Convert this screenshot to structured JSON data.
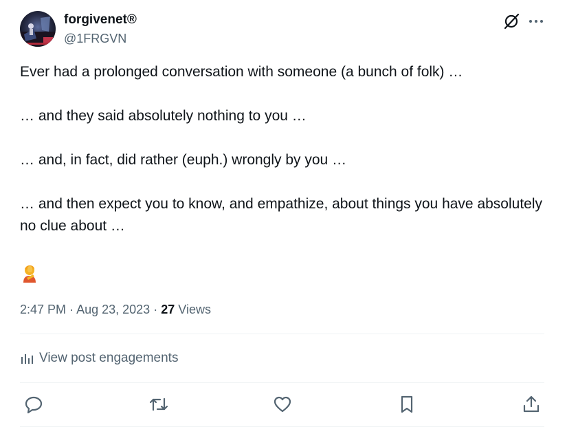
{
  "author": {
    "display_name": "forgivenet®",
    "handle": "@1FRGVN"
  },
  "post": {
    "paragraphs": [
      "Ever had a prolonged conversation with someone (a bunch of folk) …",
      "… and they said absolutely nothing to you …",
      "… and, in fact, did rather (euph.) wrongly by you …",
      "… and then expect you to know, and empathize, about things you have absolutely no clue about …"
    ],
    "emoji": "woman-facepalming",
    "time": "2:47 PM",
    "date": "Aug 23, 2023",
    "separator": "·",
    "views_count": "27",
    "views_label": "Views"
  },
  "engagements": {
    "label": "View post engagements"
  },
  "icons": {
    "top_right": [
      "grok-icon",
      "more-icon"
    ],
    "actions": [
      "reply-icon",
      "repost-icon",
      "like-icon",
      "bookmark-icon",
      "share-icon"
    ]
  },
  "colors": {
    "text": "#0f1419",
    "secondary": "#536471",
    "divider": "#eff3f4"
  }
}
